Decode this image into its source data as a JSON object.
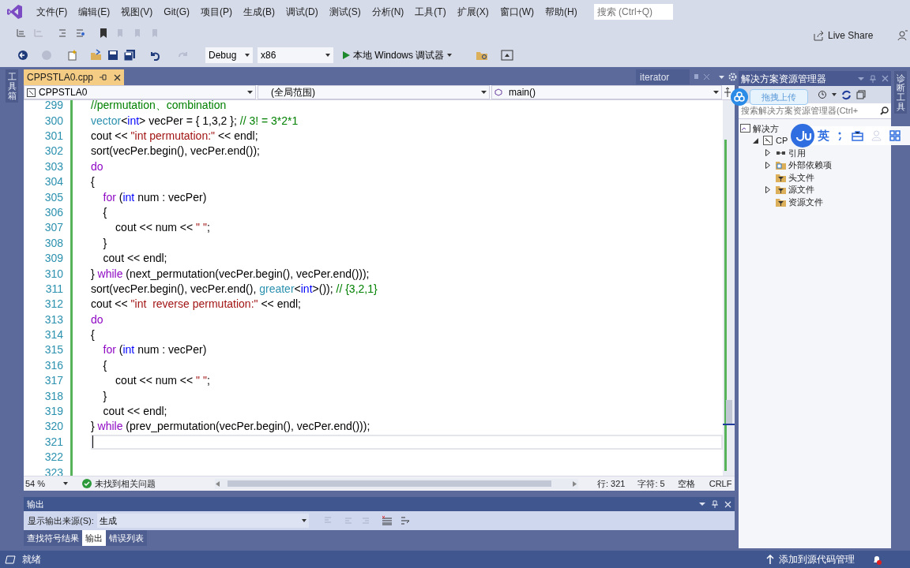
{
  "menu": [
    "文件(F)",
    "编辑(E)",
    "视图(V)",
    "Git(G)",
    "项目(P)",
    "生成(B)",
    "调试(D)",
    "测试(S)",
    "分析(N)",
    "工具(T)",
    "扩展(X)",
    "窗口(W)",
    "帮助(H)"
  ],
  "search": {
    "placeholder": "搜索 (Ctrl+Q)"
  },
  "live_share": "Live Share",
  "toolbar": {
    "configuration": "Debug",
    "platform": "x86",
    "run": "本地 Windows 调试器"
  },
  "left_strip": "工具箱",
  "right_strip": "诊断工具",
  "document_tabs": [
    {
      "label": "CPPSTLA0.cpp",
      "selected": true
    }
  ],
  "side_tab": "iterator",
  "nav_bar": {
    "project": "CPPSTLA0",
    "scope": "(全局范围)",
    "member": "main()"
  },
  "code_lines": [
    {
      "num": "299",
      "current": false,
      "tokens": [
        {
          "kind": "comment",
          "text": "//permutation、combination"
        }
      ]
    },
    {
      "num": "300",
      "current": false,
      "tokens": [
        {
          "kind": "type",
          "text": "vector"
        },
        {
          "kind": "plain",
          "text": "<"
        },
        {
          "kind": "keyword",
          "text": "int"
        },
        {
          "kind": "plain",
          "text": "> vecPer = { 1,3,2 }; "
        },
        {
          "kind": "comment",
          "text": "// 3! = 3*2*1"
        }
      ]
    },
    {
      "num": "301",
      "current": false,
      "tokens": [
        {
          "kind": "plain",
          "text": "cout << "
        },
        {
          "kind": "string",
          "text": "\"int permutation:\""
        },
        {
          "kind": "plain",
          "text": " << endl;"
        }
      ]
    },
    {
      "num": "302",
      "current": false,
      "tokens": [
        {
          "kind": "plain",
          "text": "sort(vecPer.begin(), vecPer.end());"
        }
      ]
    },
    {
      "num": "303",
      "current": false,
      "tokens": [
        {
          "kind": "control",
          "text": "do"
        }
      ]
    },
    {
      "num": "304",
      "current": false,
      "tokens": [
        {
          "kind": "plain",
          "text": "{"
        }
      ]
    },
    {
      "num": "305",
      "current": false,
      "tokens": [
        {
          "kind": "control",
          "text": "    for"
        },
        {
          "kind": "plain",
          "text": " ("
        },
        {
          "kind": "keyword",
          "text": "int"
        },
        {
          "kind": "plain",
          "text": " num : vecPer)"
        }
      ]
    },
    {
      "num": "306",
      "current": false,
      "tokens": [
        {
          "kind": "plain",
          "text": "    {"
        }
      ]
    },
    {
      "num": "307",
      "current": false,
      "tokens": [
        {
          "kind": "plain",
          "text": "        cout << num << "
        },
        {
          "kind": "string",
          "text": "\" \""
        },
        {
          "kind": "plain",
          "text": ";"
        }
      ]
    },
    {
      "num": "308",
      "current": false,
      "tokens": [
        {
          "kind": "plain",
          "text": "    }"
        }
      ]
    },
    {
      "num": "309",
      "current": false,
      "tokens": [
        {
          "kind": "plain",
          "text": "    cout << endl;"
        }
      ]
    },
    {
      "num": "310",
      "current": false,
      "tokens": [
        {
          "kind": "plain",
          "text": "} "
        },
        {
          "kind": "control",
          "text": "while"
        },
        {
          "kind": "plain",
          "text": " (next_permutation(vecPer.begin(), vecPer.end()));"
        }
      ]
    },
    {
      "num": "311",
      "current": false,
      "tokens": [
        {
          "kind": "plain",
          "text": "sort(vecPer.begin(), vecPer.end(), "
        },
        {
          "kind": "type",
          "text": "greater"
        },
        {
          "kind": "plain",
          "text": "<"
        },
        {
          "kind": "keyword",
          "text": "int"
        },
        {
          "kind": "plain",
          "text": ">()); "
        },
        {
          "kind": "comment",
          "text": "// {3,2,1}"
        }
      ]
    },
    {
      "num": "312",
      "current": false,
      "tokens": [
        {
          "kind": "plain",
          "text": "cout << "
        },
        {
          "kind": "string",
          "text": "\"int  reverse permutation:\""
        },
        {
          "kind": "plain",
          "text": " << endl;"
        }
      ]
    },
    {
      "num": "313",
      "current": false,
      "tokens": [
        {
          "kind": "control",
          "text": "do"
        }
      ]
    },
    {
      "num": "314",
      "current": false,
      "tokens": [
        {
          "kind": "plain",
          "text": "{"
        }
      ]
    },
    {
      "num": "315",
      "current": false,
      "tokens": [
        {
          "kind": "control",
          "text": "    for"
        },
        {
          "kind": "plain",
          "text": " ("
        },
        {
          "kind": "keyword",
          "text": "int"
        },
        {
          "kind": "plain",
          "text": " num : vecPer)"
        }
      ]
    },
    {
      "num": "316",
      "current": false,
      "tokens": [
        {
          "kind": "plain",
          "text": "    {"
        }
      ]
    },
    {
      "num": "317",
      "current": false,
      "tokens": [
        {
          "kind": "plain",
          "text": "        cout << num << "
        },
        {
          "kind": "string",
          "text": "\" \""
        },
        {
          "kind": "plain",
          "text": ";"
        }
      ]
    },
    {
      "num": "318",
      "current": false,
      "tokens": [
        {
          "kind": "plain",
          "text": "    }"
        }
      ]
    },
    {
      "num": "319",
      "current": false,
      "tokens": [
        {
          "kind": "plain",
          "text": "    cout << endl;"
        }
      ]
    },
    {
      "num": "320",
      "current": false,
      "tokens": [
        {
          "kind": "plain",
          "text": "} "
        },
        {
          "kind": "control",
          "text": "while"
        },
        {
          "kind": "plain",
          "text": " (prev_permutation(vecPer.begin(), vecPer.end()));"
        }
      ]
    },
    {
      "num": "321",
      "current": true
    },
    {
      "num": "322",
      "current": false
    },
    {
      "num": "323",
      "current": false
    }
  ],
  "editor_status": {
    "zoom": "54 %",
    "issues": "未找到相关问题",
    "line": "行: 321",
    "char": "字符: 5",
    "spacing": "空格",
    "eol": "CRLF"
  },
  "solution_explorer": {
    "title": "解决方案资源管理器",
    "search_placeholder": "搜索解决方案资源管理器(Ctrl+",
    "tree": [
      {
        "label": "解决方",
        "kind": "solution",
        "children": [
          {
            "label": "CP",
            "kind": "project",
            "expanded": true,
            "children": [
              {
                "label": "引用",
                "kind": "references",
                "expanded": false
              },
              {
                "label": "外部依赖项",
                "kind": "dependencies",
                "expanded": false
              },
              {
                "label": "头文件",
                "kind": "filter"
              },
              {
                "label": "源文件",
                "kind": "filter",
                "expanded": false
              },
              {
                "label": "资源文件",
                "kind": "filter"
              }
            ]
          }
        ]
      }
    ]
  },
  "upload_bubble": "拖拽上传",
  "ime_toolbar": {
    "mode": "英"
  },
  "output": {
    "title": "输出",
    "source_label": "显示输出来源(S):",
    "source": "生成",
    "tabs": [
      {
        "label": "查找符号结果",
        "selected": false
      },
      {
        "label": "输出",
        "selected": true
      },
      {
        "label": "错误列表",
        "selected": false
      }
    ]
  },
  "status_bar": {
    "text": "就绪",
    "source_control": "添加到源代码管理"
  }
}
